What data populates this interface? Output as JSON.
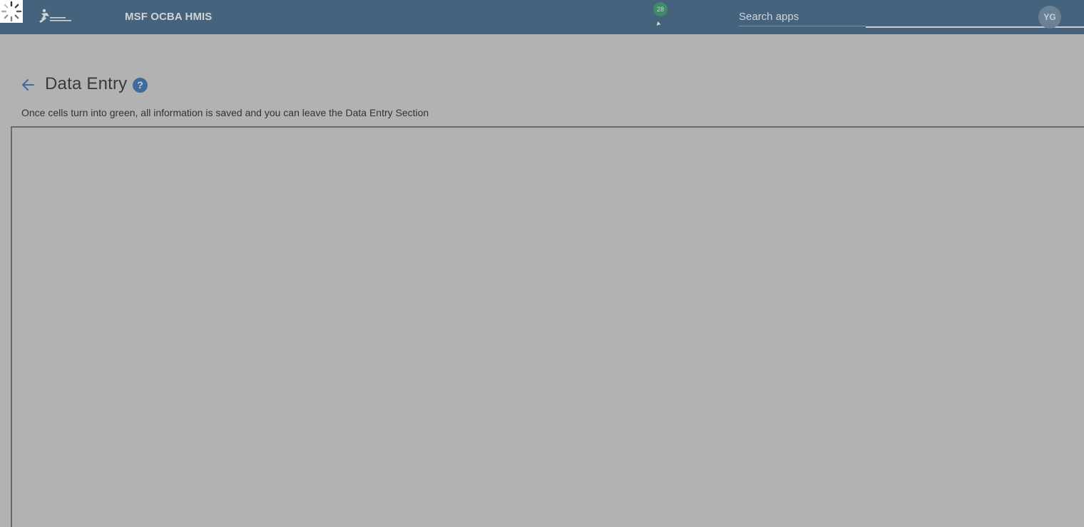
{
  "header": {
    "app_title": "MSF OCBA HMIS",
    "notification_count": "28",
    "search": {
      "placeholder": "Search apps"
    },
    "user_initials": "YG"
  },
  "icons": {
    "loading": "loading-spinner-icon",
    "logo": "msf-logo-icon",
    "back": "back-arrow-icon",
    "help": "help-icon",
    "caret": "caret-icon"
  },
  "main": {
    "title": "Data Entry",
    "help_glyph": "?",
    "instruction": "Once cells turn into green, all information is saved and you can leave the Data Entry Section"
  },
  "colors": {
    "header_bg": "#45637c",
    "overlay_bg": "#b2b2b2",
    "badge_bg": "#3f8a6b",
    "accent": "#3f6a9a"
  }
}
